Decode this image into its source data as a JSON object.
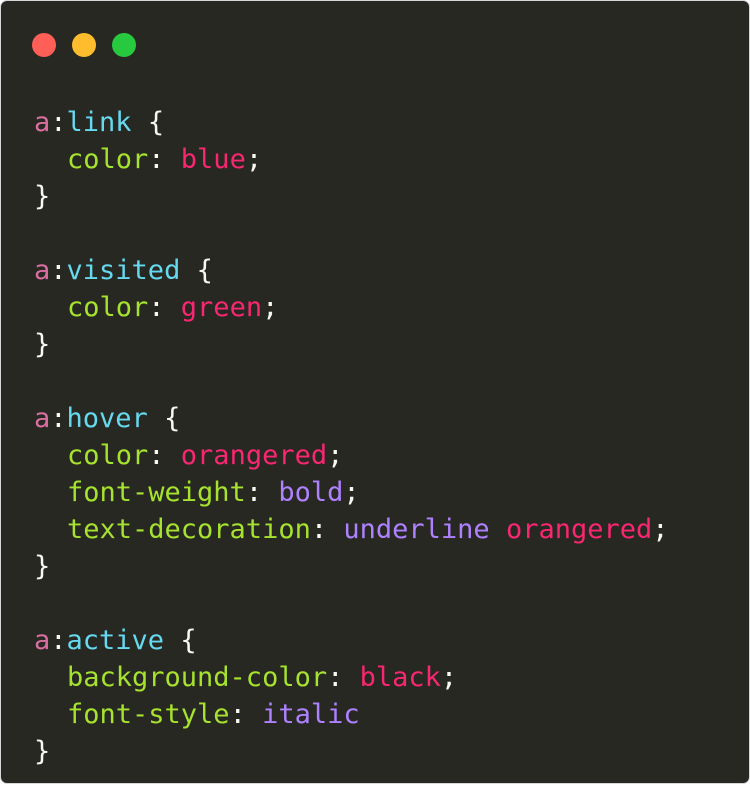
{
  "window": {
    "buttons": [
      {
        "name": "close",
        "color": "#ff5f56"
      },
      {
        "name": "minimize",
        "color": "#ffbd2e"
      },
      {
        "name": "maximize",
        "color": "#27c93f"
      }
    ],
    "background": "#272822"
  },
  "code": {
    "blocks": [
      {
        "selector": {
          "tag": "a",
          "colon": ":",
          "pseudo": "link",
          "open": " {"
        },
        "declarations": [
          {
            "prop": "color",
            "sep": ": ",
            "values": [
              {
                "text": "blue",
                "kind": "keyword-red"
              }
            ],
            "end": ";"
          }
        ],
        "close": "}"
      },
      {
        "selector": {
          "tag": "a",
          "colon": ":",
          "pseudo": "visited",
          "open": " {"
        },
        "declarations": [
          {
            "prop": "color",
            "sep": ": ",
            "values": [
              {
                "text": "green",
                "kind": "keyword-red"
              }
            ],
            "end": ";"
          }
        ],
        "close": "}"
      },
      {
        "selector": {
          "tag": "a",
          "colon": ":",
          "pseudo": "hover",
          "open": " {"
        },
        "declarations": [
          {
            "prop": "color",
            "sep": ": ",
            "values": [
              {
                "text": "orangered",
                "kind": "keyword-red"
              }
            ],
            "end": ";"
          },
          {
            "prop": "font-weight",
            "sep": ": ",
            "values": [
              {
                "text": "bold",
                "kind": "keyword-purple"
              }
            ],
            "end": ";"
          },
          {
            "prop": "text-decoration",
            "sep": ": ",
            "values": [
              {
                "text": "underline",
                "kind": "keyword-purple"
              },
              {
                "text": " ",
                "kind": "space"
              },
              {
                "text": "orangered",
                "kind": "keyword-red"
              }
            ],
            "end": ";"
          }
        ],
        "close": "}"
      },
      {
        "selector": {
          "tag": "a",
          "colon": ":",
          "pseudo": "active",
          "open": " {"
        },
        "declarations": [
          {
            "prop": "background-color",
            "sep": ": ",
            "values": [
              {
                "text": "black",
                "kind": "keyword-red"
              }
            ],
            "end": ";"
          },
          {
            "prop": "font-style",
            "sep": ": ",
            "values": [
              {
                "text": "italic",
                "kind": "keyword-purple"
              }
            ],
            "end": ""
          }
        ],
        "close": "}"
      }
    ]
  },
  "colors": {
    "tag": "#d96ea0",
    "pseudo": "#66d9ef",
    "property": "#a6e22e",
    "punctuation": "#f8f8f2",
    "keyword-red": "#f92672",
    "keyword-purple": "#ae81ff"
  }
}
